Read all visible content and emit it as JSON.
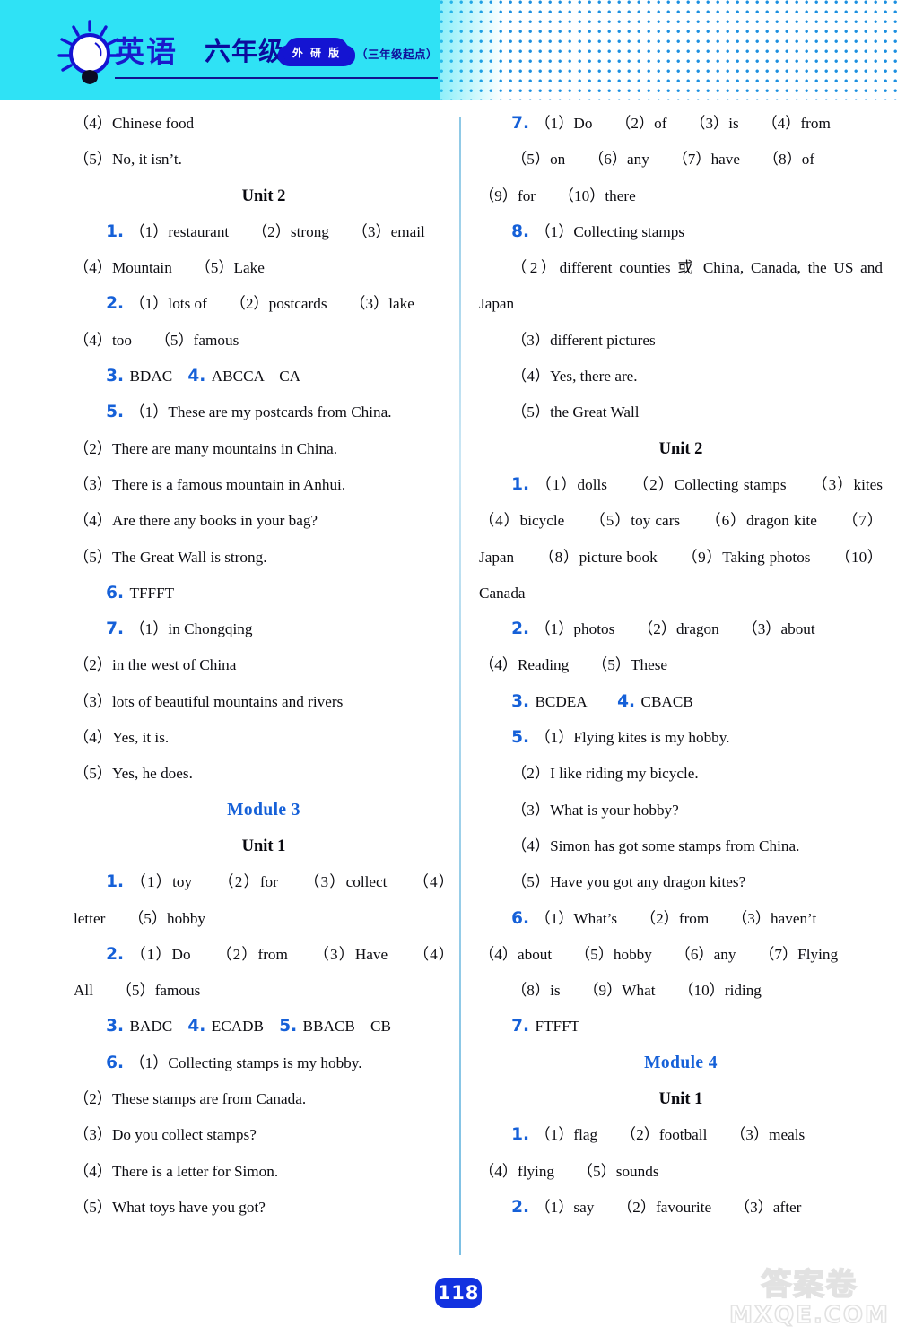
{
  "header": {
    "bulb_icon": "lightbulb-icon",
    "subject": "英语",
    "grade": "六年级上",
    "publisher_badge": "外 研 版",
    "start_note": "（三年级起点）"
  },
  "footer": {
    "page_number": "118",
    "watermark_cn": "答案卷",
    "watermark_en": "MXQE.COM"
  },
  "colors": {
    "banner": "#2fe2f5",
    "accent_blue": "#1560d8",
    "heading_blue": "#1560d8",
    "title_blue": "#1a1acb",
    "dot_blue": "#1b8fe0"
  },
  "left_column": [
    {
      "type": "answer",
      "indent": false,
      "num": "",
      "text": "（4）Chinese food"
    },
    {
      "type": "answer",
      "indent": false,
      "num": "",
      "text": "（5）No, it isn’t."
    },
    {
      "type": "unit",
      "text": "Unit 2"
    },
    {
      "type": "answer",
      "indent": true,
      "num": "1.",
      "text": "（1）restaurant　　（2）strong　　（3）email"
    },
    {
      "type": "answer",
      "indent": false,
      "num": "",
      "text": "（4）Mountain　　（5）Lake"
    },
    {
      "type": "answer",
      "indent": true,
      "num": "2.",
      "text": "（1）lots of　　（2）postcards　　（3）lake"
    },
    {
      "type": "answer",
      "indent": false,
      "num": "",
      "text": "（4）too　　（5）famous"
    },
    {
      "type": "answer-two",
      "indent": true,
      "num": "3.",
      "text": "BDAC　",
      "num2": "4.",
      "text2": "ABCCA　CA"
    },
    {
      "type": "answer",
      "indent": true,
      "num": "5.",
      "text": "（1）These are my postcards from China."
    },
    {
      "type": "answer",
      "indent": false,
      "num": "",
      "text": "（2）There are many mountains in China."
    },
    {
      "type": "answer",
      "indent": false,
      "num": "",
      "text": "（3）There is a famous mountain in Anhui."
    },
    {
      "type": "answer",
      "indent": false,
      "num": "",
      "text": "（4）Are there any books in your bag?"
    },
    {
      "type": "answer",
      "indent": false,
      "num": "",
      "text": "（5）The Great Wall is strong."
    },
    {
      "type": "answer",
      "indent": true,
      "num": "6.",
      "text": "TFFFT"
    },
    {
      "type": "answer",
      "indent": true,
      "num": "7.",
      "text": "（1）in Chongqing"
    },
    {
      "type": "answer",
      "indent": false,
      "num": "",
      "text": "（2）in the west of China"
    },
    {
      "type": "answer",
      "indent": false,
      "num": "",
      "text": "（3）lots of beautiful mountains and rivers"
    },
    {
      "type": "answer",
      "indent": false,
      "num": "",
      "text": "（4）Yes, it is."
    },
    {
      "type": "answer",
      "indent": false,
      "num": "",
      "text": "（5）Yes, he does."
    },
    {
      "type": "module",
      "text": "Module 3"
    },
    {
      "type": "unit",
      "text": "Unit 1"
    },
    {
      "type": "answer",
      "indent": true,
      "num": "1.",
      "text": "（1）toy　　（2）for　　（3）collect　　（4）letter　　（5）hobby"
    },
    {
      "type": "answer",
      "indent": true,
      "num": "2.",
      "text": "（1）Do　　（2）from　　（3）Have　　（4）All　　（5）famous"
    },
    {
      "type": "answer-three",
      "indent": true,
      "num": "3.",
      "text": "BADC　",
      "num2": "4.",
      "text2": "ECADB　",
      "num3": "5.",
      "text3": "BBACB　CB"
    },
    {
      "type": "answer",
      "indent": true,
      "num": "6.",
      "text": "（1）Collecting stamps is my hobby."
    },
    {
      "type": "answer",
      "indent": false,
      "num": "",
      "text": "（2）These stamps are from Canada."
    },
    {
      "type": "answer",
      "indent": false,
      "num": "",
      "text": "（3）Do you collect stamps?"
    },
    {
      "type": "answer",
      "indent": false,
      "num": "",
      "text": "（4）There is a letter for Simon."
    },
    {
      "type": "answer",
      "indent": false,
      "num": "",
      "text": "（5）What toys have you got?"
    }
  ],
  "right_column": [
    {
      "type": "answer",
      "indent": true,
      "num": "7.",
      "text": "（1）Do　　（2）of　　（3）is　　（4）from"
    },
    {
      "type": "answer",
      "indent": true,
      "num": "",
      "text": "（5）on　　（6）any　　（7）have　　（8）of"
    },
    {
      "type": "answer",
      "indent": false,
      "num": "",
      "text": "（9）for　　（10）there"
    },
    {
      "type": "answer",
      "indent": true,
      "num": "8.",
      "text": "（1）Collecting stamps"
    },
    {
      "type": "answer",
      "indent": true,
      "num": "",
      "text": "（2）different counties 或 China, Canada, the US and Japan"
    },
    {
      "type": "answer",
      "indent": true,
      "num": "",
      "text": "（3）different pictures"
    },
    {
      "type": "answer",
      "indent": true,
      "num": "",
      "text": "（4）Yes, there are."
    },
    {
      "type": "answer",
      "indent": true,
      "num": "",
      "text": "（5）the Great Wall"
    },
    {
      "type": "unit",
      "text": "Unit 2"
    },
    {
      "type": "answer",
      "indent": true,
      "num": "1.",
      "text": "（1）dolls　　（2）Collecting stamps　　（3）kites　　（4）bicycle　　（5）toy cars　　（6）dragon kite　　（7）Japan　　（8）picture book　　（9）Taking photos　　（10）Canada"
    },
    {
      "type": "answer",
      "indent": true,
      "num": "2.",
      "text": "（1）photos　　（2）dragon　　（3）about"
    },
    {
      "type": "answer",
      "indent": false,
      "num": "",
      "text": "（4）Reading　　（5）These"
    },
    {
      "type": "answer-two",
      "indent": true,
      "num": "3.",
      "text": "BCDEA　　",
      "num2": "4.",
      "text2": "CBACB"
    },
    {
      "type": "answer",
      "indent": true,
      "num": "5.",
      "text": "（1）Flying kites is my hobby."
    },
    {
      "type": "answer",
      "indent": true,
      "num": "",
      "text": "（2）I like riding my bicycle."
    },
    {
      "type": "answer",
      "indent": true,
      "num": "",
      "text": "（3）What is your hobby?"
    },
    {
      "type": "answer",
      "indent": true,
      "num": "",
      "text": "（4）Simon has got some stamps from China."
    },
    {
      "type": "answer",
      "indent": true,
      "num": "",
      "text": "（5）Have you got any dragon kites?"
    },
    {
      "type": "answer",
      "indent": true,
      "num": "6.",
      "text": "（1）What’s　　（2）from　　（3）haven’t"
    },
    {
      "type": "answer",
      "indent": false,
      "num": "",
      "text": "（4）about　　（5）hobby　　（6）any　　（7）Flying"
    },
    {
      "type": "answer",
      "indent": true,
      "num": "",
      "text": "（8）is　　（9）What　　（10）riding"
    },
    {
      "type": "answer",
      "indent": true,
      "num": "7.",
      "text": "FTFFT"
    },
    {
      "type": "module",
      "text": "Module 4"
    },
    {
      "type": "unit",
      "text": "Unit 1"
    },
    {
      "type": "answer",
      "indent": true,
      "num": "1.",
      "text": "（1）flag　　（2）football　　（3）meals"
    },
    {
      "type": "answer",
      "indent": false,
      "num": "",
      "text": "（4）flying　　（5）sounds"
    },
    {
      "type": "answer",
      "indent": true,
      "num": "2.",
      "text": "（1）say　　（2）favourite　　（3）after"
    }
  ]
}
